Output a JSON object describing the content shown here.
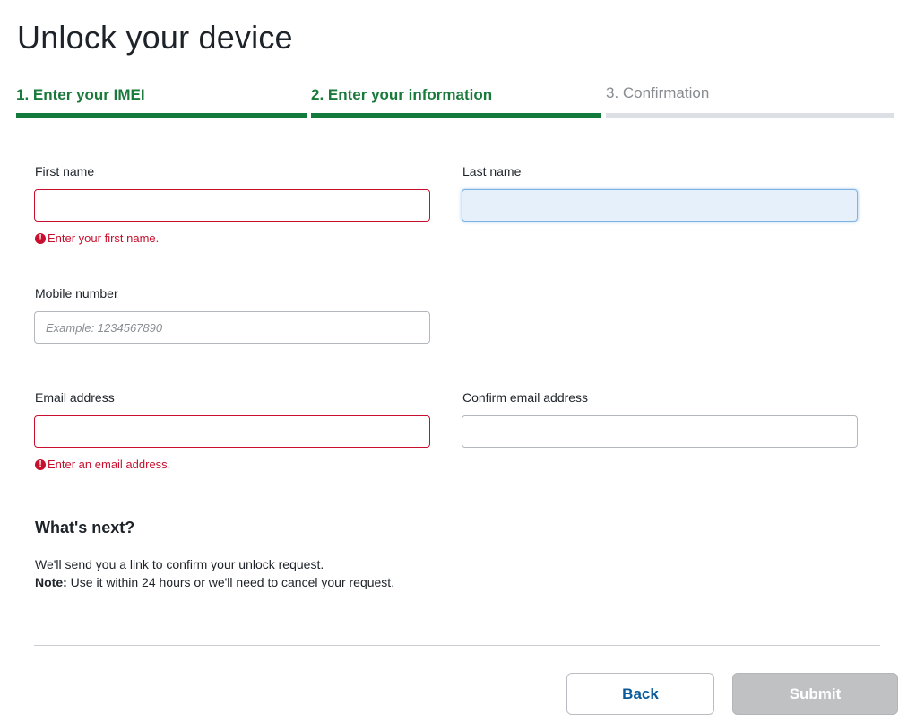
{
  "page_title": "Unlock your device",
  "steps": [
    {
      "label": "1. Enter your IMEI",
      "state": "done"
    },
    {
      "label": "2. Enter your information",
      "state": "current"
    },
    {
      "label": "3. Confirmation",
      "state": "todo"
    }
  ],
  "colors": {
    "step_active": "#127a3a",
    "step_inactive": "#dcdfe3",
    "error": "#c8102e",
    "link_blue": "#0a5a99",
    "disabled_button": "#bfc1c3"
  },
  "form": {
    "first_name": {
      "label": "First name",
      "value": "",
      "error": "Enter your first name."
    },
    "last_name": {
      "label": "Last name",
      "value": ""
    },
    "mobile": {
      "label": "Mobile number",
      "value": "",
      "placeholder": "Example: 1234567890"
    },
    "email": {
      "label": "Email address",
      "value": "",
      "error": "Enter an email address."
    },
    "confirm_email": {
      "label": "Confirm email address",
      "value": ""
    }
  },
  "whats_next": {
    "heading": "What's next?",
    "line1": "We'll send you a link to confirm your unlock request.",
    "note_label": "Note:",
    "note_text": " Use it within 24 hours or we'll need to cancel your request."
  },
  "buttons": {
    "back": "Back",
    "submit": "Submit"
  },
  "icons": {
    "error": "exclamation-circle-icon"
  }
}
